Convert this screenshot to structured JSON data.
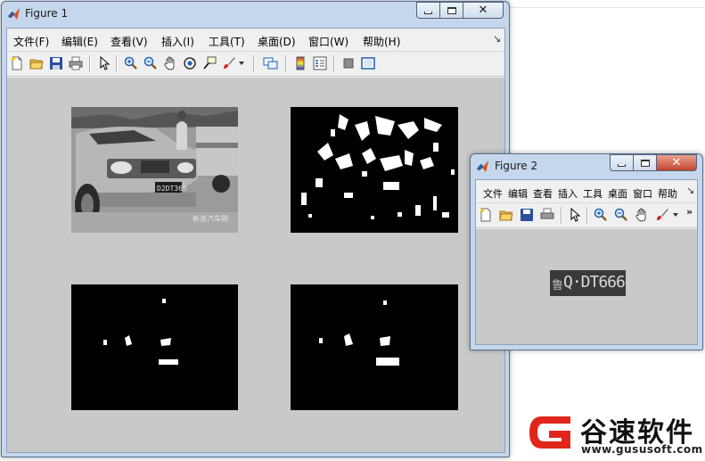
{
  "figure1": {
    "title": "Figure 1",
    "menu": [
      "文件(F)",
      "编辑(E)",
      "查看(V)",
      "插入(I)",
      "工具(T)",
      "桌面(D)",
      "窗口(W)",
      "帮助(H)"
    ],
    "menu_arrow": "↘",
    "toolbar": [
      "new-figure",
      "open-file",
      "save",
      "print",
      "select-arrow",
      "zoom-in",
      "zoom-out",
      "pan",
      "rotate-3d",
      "data-cursor",
      "brush",
      "brush-dropdown",
      "link-plot",
      "colorbar",
      "legend",
      "hide-plot-tools",
      "show-plot-tools"
    ],
    "subplots": [
      {
        "name": "grayscale-car-photo",
        "caption": "新浪汽车网",
        "plate": "D2 D T365"
      },
      {
        "name": "edge-binary-image"
      },
      {
        "name": "morphology-binary-image"
      },
      {
        "name": "filtered-binary-image"
      }
    ]
  },
  "figure2": {
    "title": "Figure 2",
    "menu": [
      "文件",
      "编辑",
      "查看",
      "插入",
      "工具",
      "桌面",
      "窗口",
      "帮助"
    ],
    "menu_arrow": "↘",
    "toolbar_more": "»",
    "plate_prefix": "鲁",
    "plate_text": "Q·DT666"
  },
  "watermark": {
    "title": "谷速软件",
    "url": "www.gususoft.com",
    "brand_color": "#e0261b"
  },
  "colors": {
    "title_active": "#c4d7ec",
    "close_button": "#c4452f",
    "figure_background": "#c9c9c9"
  }
}
